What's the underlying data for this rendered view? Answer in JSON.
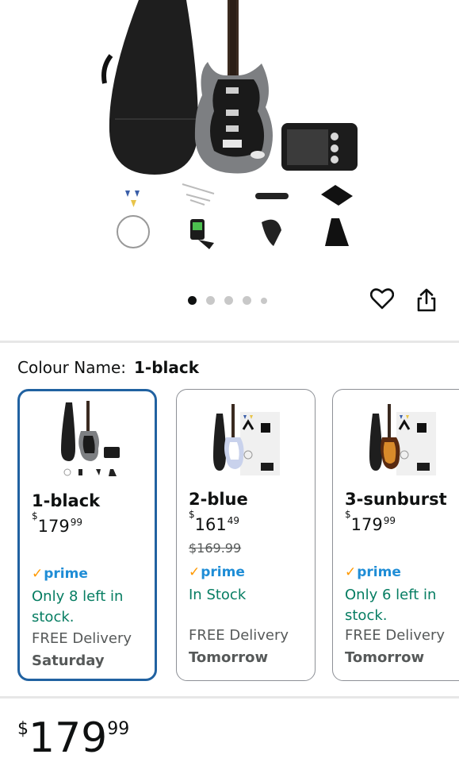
{
  "gallery": {
    "dots_count": 5,
    "active_dot": 0
  },
  "actions": {
    "wishlist_icon": "heart-icon",
    "share_icon": "share-icon"
  },
  "colour": {
    "label": "Colour Name:",
    "selected": "1-black"
  },
  "variants": [
    {
      "name": "1-black",
      "currency": "$",
      "price_whole": "179",
      "price_cents": "99",
      "was_price": "",
      "prime": "prime",
      "stock": "Only 8 left in stock.",
      "delivery": "FREE Delivery",
      "delivery_day": "Saturday",
      "selected": true
    },
    {
      "name": "2-blue",
      "currency": "$",
      "price_whole": "161",
      "price_cents": "49",
      "was_price": "$169.99",
      "prime": "prime",
      "stock": "In Stock",
      "delivery": "FREE Delivery",
      "delivery_day": "Tomorrow",
      "selected": false
    },
    {
      "name": "3-sunburst",
      "currency": "$",
      "price_whole": "179",
      "price_cents": "99",
      "was_price": "",
      "prime": "prime",
      "stock": "Only 6 left in stock.",
      "delivery": "FREE Delivery",
      "delivery_day": "Tomorrow",
      "selected": false
    }
  ],
  "main_price": {
    "currency": "$",
    "whole": "179",
    "cents": "99"
  },
  "colors": {
    "selected_border": "#2162a1",
    "stock_green": "#067d62",
    "prime_blue": "#1f8dd6",
    "prime_check": "#ff9900"
  }
}
